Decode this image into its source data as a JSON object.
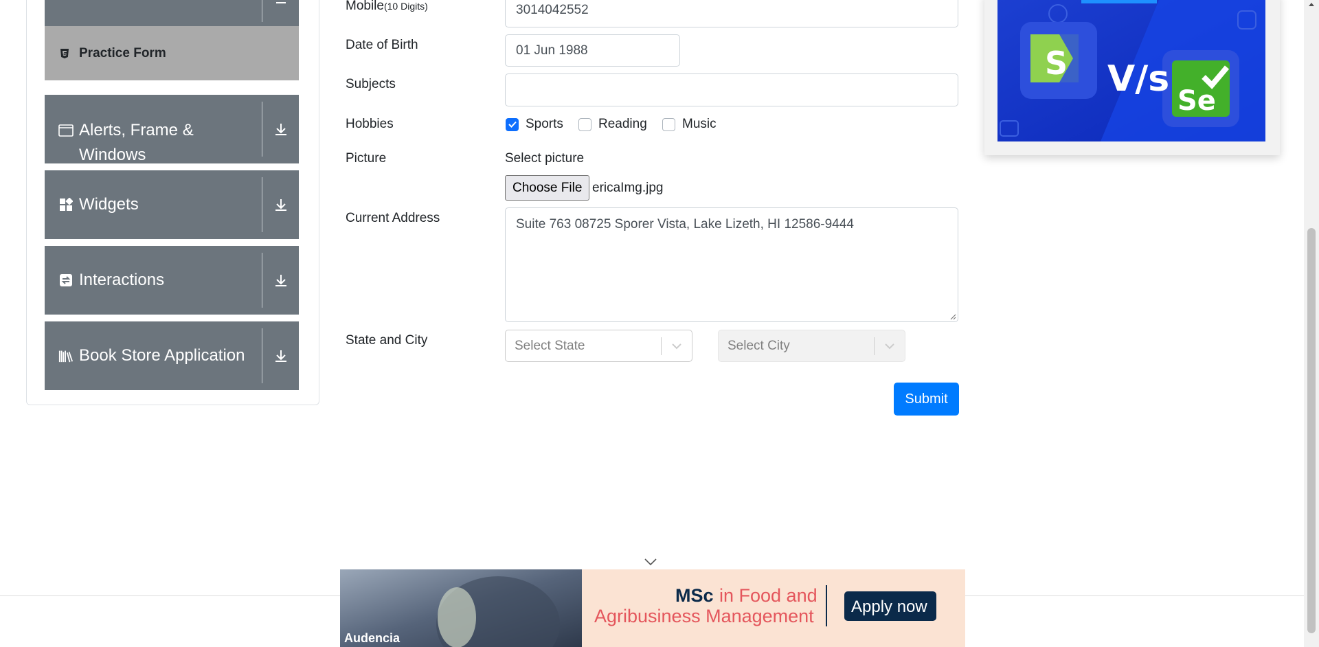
{
  "sidebar": {
    "active_item": {
      "label": "Practice Form",
      "icon": "html5-icon"
    },
    "groups": [
      {
        "label": "Alerts, Frame &",
        "label2": "Windows",
        "icon": "window-icon"
      },
      {
        "label": "Widgets",
        "icon": "widgets-icon"
      },
      {
        "label": "Interactions",
        "icon": "interactions-icon"
      },
      {
        "label": "Book Store Application",
        "icon": "books-icon"
      }
    ]
  },
  "form": {
    "mobile_label": "Mobile",
    "mobile_hint": "(10 Digits)",
    "mobile_value": "3014042552",
    "dob_label": "Date of Birth",
    "dob_value": "01 Jun 1988",
    "subjects_label": "Subjects",
    "subjects_value": "",
    "hobbies_label": "Hobbies",
    "hobbies": [
      {
        "label": "Sports",
        "checked": true
      },
      {
        "label": "Reading",
        "checked": false
      },
      {
        "label": "Music",
        "checked": false
      }
    ],
    "picture_label": "Picture",
    "select_picture_label": "Select picture",
    "choose_file_label": "Choose File",
    "file_name": "ericaImg.jpg",
    "address_label": "Current Address",
    "address_value": "Suite 763 08725 Sporer Vista, Lake Lizeth, HI 12586-9444",
    "state_city_label": "State and City",
    "state_placeholder": "Select State",
    "city_placeholder": "Select City",
    "submit_label": "Submit"
  },
  "promo": {
    "vs_text": "V/s",
    "left_logo": "S",
    "right_logo": "Se"
  },
  "ad": {
    "brand": "Audencia",
    "headline_1": "MSc",
    "headline_2": "in Food and",
    "headline_3": "Agribusiness Management",
    "cta": "Apply now"
  },
  "colors": {
    "primary": "#007bff",
    "sidebar": "#6c757d",
    "active": "#aaaaaa",
    "ad_accent": "#e4565c",
    "ad_navy": "#0b2a4a"
  }
}
